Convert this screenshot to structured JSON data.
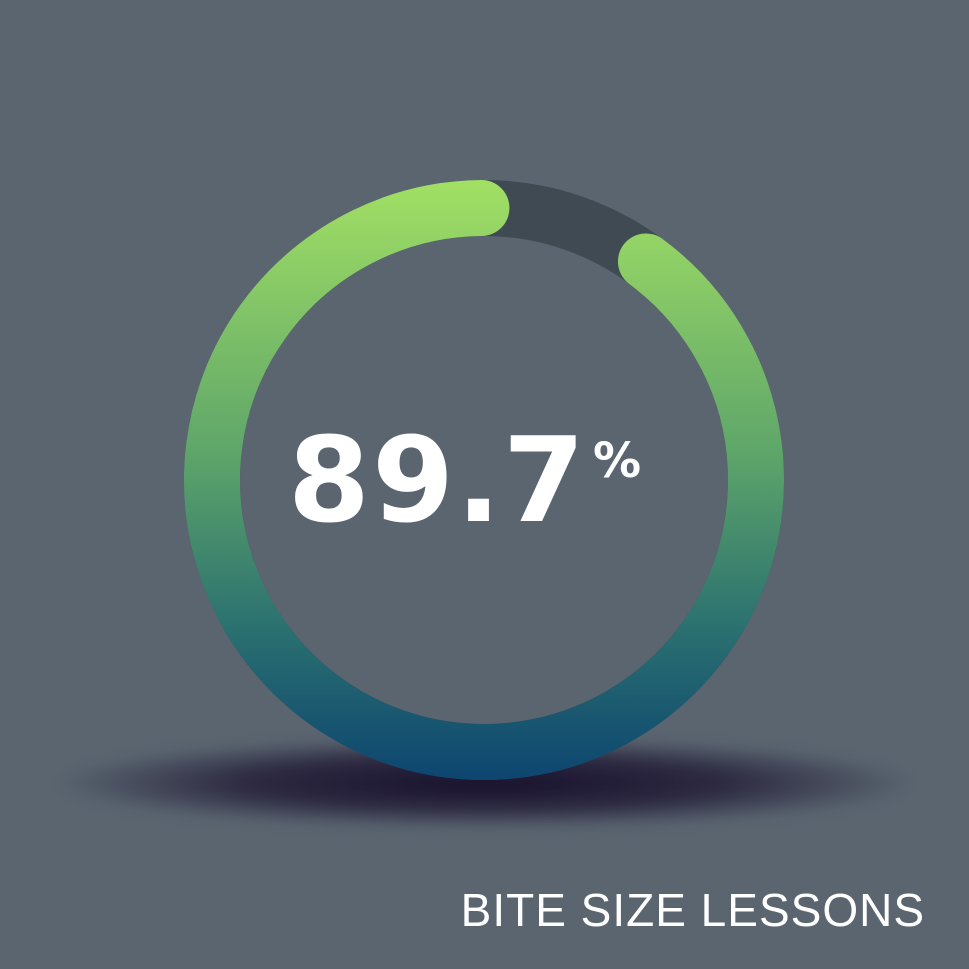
{
  "gauge": {
    "value_text": "89.7",
    "unit": "%",
    "fraction": 0.897,
    "gradient_top": "#a2e064",
    "gradient_bottom": "#0d4570",
    "track_color": "#404a53"
  },
  "background_color": "#5a6570",
  "brand": {
    "text": "BITE SIZE LESSONS"
  }
}
